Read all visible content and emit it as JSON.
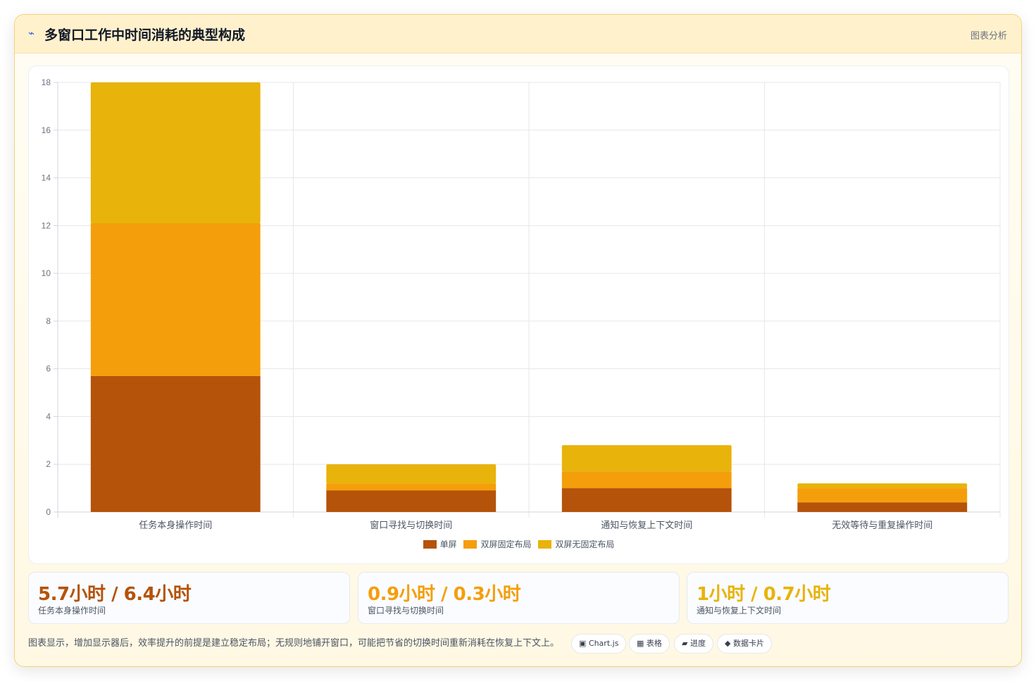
{
  "header": {
    "icon": "lightning-icon",
    "title": "多窗口工作中时间消耗的典型构成",
    "tag": "图表分析"
  },
  "chart_data": {
    "type": "bar",
    "stacked": true,
    "categories": [
      "任务本身操作时间",
      "窗口寻找与切换时间",
      "通知与恢复上下文时间",
      "无效等待与重复操作时间"
    ],
    "series": [
      {
        "name": "单屏",
        "color": "#b45309",
        "values": [
          5.7,
          0.9,
          1.0,
          0.4
        ]
      },
      {
        "name": "双屏固定布局",
        "color": "#f59e0b",
        "values": [
          6.4,
          0.3,
          0.7,
          0.6
        ]
      },
      {
        "name": "双屏无固定布局",
        "color": "#e8b30a",
        "values": [
          5.9,
          0.8,
          1.1,
          0.2
        ]
      }
    ],
    "ylim": [
      0,
      18
    ],
    "yticks": [
      0,
      2,
      4,
      6,
      8,
      10,
      12,
      14,
      16,
      18
    ],
    "grid": true,
    "legend": "bottom"
  },
  "stats": [
    {
      "value": "5.7小时 / 6.4小时",
      "label": "任务本身操作时间",
      "color": "#b45309"
    },
    {
      "value": "0.9小时 / 0.3小时",
      "label": "窗口寻找与切换时间",
      "color": "#f59e0b"
    },
    {
      "value": "1小时 / 0.7小时",
      "label": "通知与恢复上下文时间",
      "color": "#e8b30a"
    }
  ],
  "footer": {
    "text": "图表显示，增加显示器后，效率提升的前提是建立稳定布局；无规则地铺开窗口，可能把节省的切换时间重新消耗在恢复上下文上。",
    "chips": [
      {
        "icon": "▣",
        "label": "Chart.js"
      },
      {
        "icon": "▦",
        "label": "表格"
      },
      {
        "icon": "▰",
        "label": "进度"
      },
      {
        "icon": "◆",
        "label": "数据卡片"
      }
    ]
  }
}
